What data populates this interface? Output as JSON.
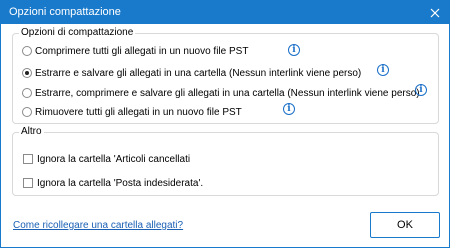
{
  "window": {
    "title": "Opzioni compattazione",
    "accent_color": "#1979ca"
  },
  "compaction_options": {
    "legend": "Opzioni di compattazione",
    "selected_index": 1,
    "options": [
      {
        "label": "Comprimere tutti gli allegati in un nuovo file PST"
      },
      {
        "label": "Estrarre e salvare gli allegati in una cartella (Nessun interlink viene perso)"
      },
      {
        "label": "Estrarre, comprimere e salvare gli allegati in una cartella (Nessun interlink viene perso)"
      },
      {
        "label": "Rimuovere tutti gli allegati in un nuovo file PST"
      }
    ],
    "info_icon_glyph": "i"
  },
  "altro": {
    "legend": "Altro",
    "checkboxes": [
      {
        "label": "Ignora la cartella 'Articoli cancellati",
        "checked": false
      },
      {
        "label": "Ignora la cartella 'Posta indesiderata'.",
        "checked": false
      }
    ]
  },
  "footer": {
    "help_link": "Come ricollegare una cartella allegati?",
    "ok_label": "OK"
  }
}
